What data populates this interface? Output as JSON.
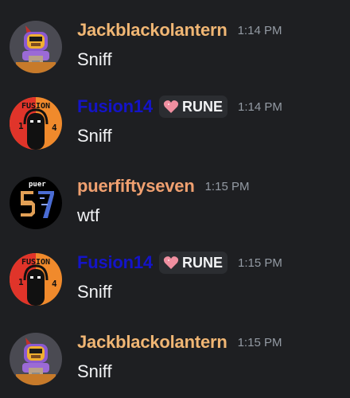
{
  "messages": [
    {
      "username": "Jackblackolantern",
      "username_color": "#f0b674",
      "tag": "",
      "timestamp": "1:14 PM",
      "text": "Sniff",
      "avatar_icon": "pumpkin-lantern-avatar"
    },
    {
      "username": "Fusion14",
      "username_color": "#1414c8",
      "tag": "RUNE",
      "timestamp": "1:14 PM",
      "text": "Sniff",
      "avatar_icon": "fusion-orange-red-avatar",
      "avatar_text": "FUSION",
      "avatar_left_digit": "1",
      "avatar_right_digit": "4"
    },
    {
      "username": "puerfiftyseven",
      "username_color": "#f0a070",
      "tag": "",
      "timestamp": "1:15 PM",
      "text": "wtf",
      "avatar_icon": "number-57-avatar",
      "avatar_text": "puer"
    },
    {
      "username": "Fusion14",
      "username_color": "#1414c8",
      "tag": "RUNE",
      "timestamp": "1:15 PM",
      "text": "Sniff",
      "avatar_icon": "fusion-orange-red-avatar",
      "avatar_text": "FUSION",
      "avatar_left_digit": "1",
      "avatar_right_digit": "4"
    },
    {
      "username": "Jackblackolantern",
      "username_color": "#f0b674",
      "tag": "",
      "timestamp": "1:15 PM",
      "text": "Sniff",
      "avatar_icon": "pumpkin-lantern-avatar"
    }
  ],
  "colors": {
    "background": "#1e1f22",
    "timestamp": "#949ba4",
    "tag_background": "#2b2d31",
    "tag_heart": "#f08fa0"
  }
}
